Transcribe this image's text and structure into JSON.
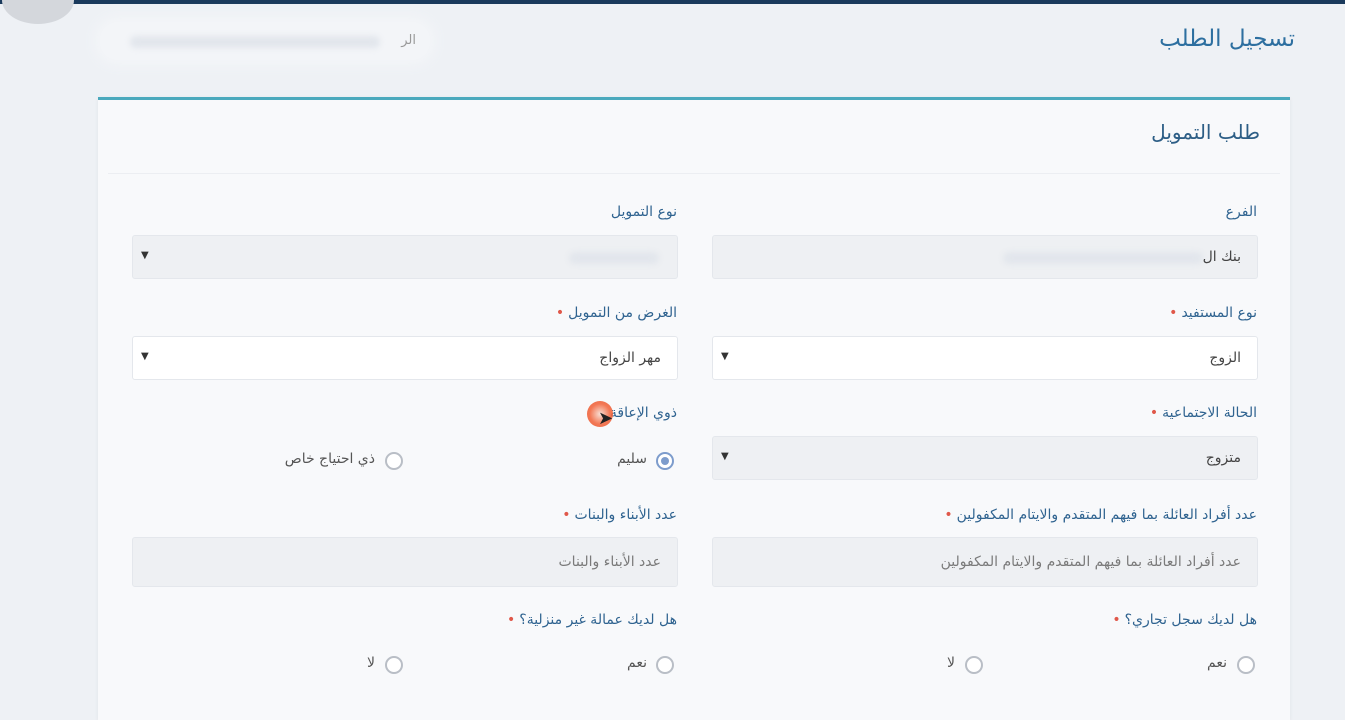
{
  "header": {
    "page_title": "تسجيل الطلب",
    "search_placeholder": "الر"
  },
  "card": {
    "title": "طلب التمويل"
  },
  "form": {
    "branch": {
      "label": "الفرع",
      "value": "بنك ال"
    },
    "financing_type": {
      "label": "نوع التمويل"
    },
    "beneficiary_type": {
      "label": "نوع المستفيد",
      "value": "الزوج"
    },
    "financing_purpose": {
      "label": "الغرض من التمويل",
      "value": "مهر الزواج"
    },
    "marital_status": {
      "label": "الحالة الاجتماعية",
      "value": "متزوج"
    },
    "disability": {
      "label": "ذوي الإعاقة",
      "options": [
        {
          "label": "سليم",
          "checked": true
        },
        {
          "label": "ذي احتياج خاص",
          "checked": false
        }
      ]
    },
    "family_members": {
      "label": "عدد أفراد العائلة بما فيهم المتقدم والايتام المكفولين",
      "placeholder": "عدد أفراد العائلة بما فيهم المتقدم والايتام المكفولين"
    },
    "children_count": {
      "label": "عدد الأبناء والبنات",
      "placeholder": "عدد الأبناء والبنات"
    },
    "commercial_register": {
      "label": "هل لديك سجل تجاري؟",
      "options": [
        {
          "label": "نعم",
          "checked": false
        },
        {
          "label": "لا",
          "checked": false
        }
      ]
    },
    "non_domestic_labor": {
      "label": "هل لديك عمالة غير منزلية؟",
      "options": [
        {
          "label": "نعم",
          "checked": false
        },
        {
          "label": "لا",
          "checked": false
        }
      ]
    }
  },
  "required_marker": "•",
  "colors": {
    "accent": "#4aa9bd",
    "label": "#2f6390",
    "required": "#e0584a"
  }
}
